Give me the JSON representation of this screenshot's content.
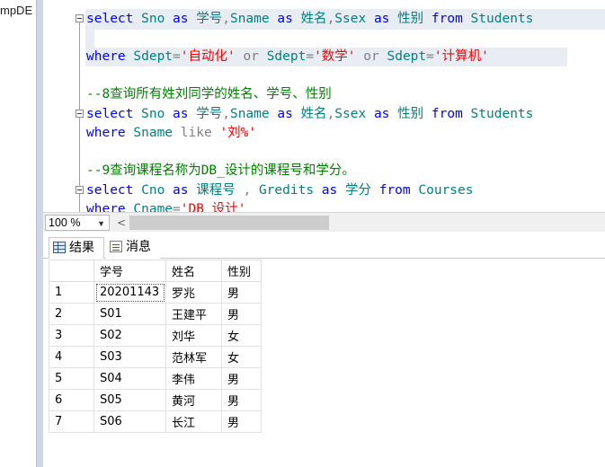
{
  "left_pane": {
    "db_label": "mpDE"
  },
  "editor": {
    "lines": [
      [
        [
          "kw",
          "select "
        ],
        [
          "id",
          "Sno "
        ],
        [
          "kw",
          "as "
        ],
        [
          "tx",
          "学号"
        ],
        [
          "op",
          ","
        ],
        [
          "id",
          "Sname "
        ],
        [
          "kw",
          "as "
        ],
        [
          "tx",
          "姓名"
        ],
        [
          "op",
          ","
        ],
        [
          "id",
          "Ssex "
        ],
        [
          "kw",
          "as "
        ],
        [
          "tx",
          "性别 "
        ],
        [
          "kw",
          "from "
        ],
        [
          "id",
          "Students"
        ]
      ],
      [
        [
          "kw",
          "where "
        ],
        [
          "id",
          "Sdept"
        ],
        [
          "op",
          "="
        ],
        [
          "str",
          "'自动化' "
        ],
        [
          "op",
          "or "
        ],
        [
          "id",
          "Sdept"
        ],
        [
          "op",
          "="
        ],
        [
          "str",
          "'数学' "
        ],
        [
          "op",
          "or "
        ],
        [
          "id",
          "Sdept"
        ],
        [
          "op",
          "="
        ],
        [
          "str",
          "'计算机'"
        ]
      ],
      [
        [
          "cm",
          "--8查询所有姓刘同学的姓名、学号、性别"
        ]
      ],
      [
        [
          "kw",
          "select "
        ],
        [
          "id",
          "Sno "
        ],
        [
          "kw",
          "as "
        ],
        [
          "tx",
          "学号"
        ],
        [
          "op",
          ","
        ],
        [
          "id",
          "Sname "
        ],
        [
          "kw",
          "as "
        ],
        [
          "tx",
          "姓名"
        ],
        [
          "op",
          ","
        ],
        [
          "id",
          "Ssex "
        ],
        [
          "kw",
          "as "
        ],
        [
          "tx",
          "性别 "
        ],
        [
          "kw",
          "from "
        ],
        [
          "id",
          "Students"
        ]
      ],
      [
        [
          "kw",
          "where "
        ],
        [
          "id",
          "Sname "
        ],
        [
          "op",
          "like "
        ],
        [
          "str",
          "'刘%'"
        ]
      ],
      [
        [
          "cm",
          "--9查询课程名称为DB_设计的课程号和学分。"
        ]
      ],
      [
        [
          "kw",
          "select "
        ],
        [
          "id",
          "Cno "
        ],
        [
          "kw",
          "as "
        ],
        [
          "tx",
          "课程号 "
        ],
        [
          "op",
          ", "
        ],
        [
          "id",
          "Gredits "
        ],
        [
          "kw",
          "as "
        ],
        [
          "tx",
          "学分 "
        ],
        [
          "kw",
          "from "
        ],
        [
          "id",
          "Courses"
        ]
      ],
      [
        [
          "kw",
          "where "
        ],
        [
          "id",
          "Cname"
        ],
        [
          "op",
          "="
        ],
        [
          "str",
          "'DB_设计'"
        ]
      ]
    ]
  },
  "zoom": {
    "value": "100 %"
  },
  "tabs": {
    "results": "结果",
    "messages": "消息"
  },
  "grid": {
    "headers": [
      "学号",
      "姓名",
      "性别"
    ],
    "rows": [
      [
        "1",
        "20201143",
        "罗兆",
        "男"
      ],
      [
        "2",
        "S01",
        "王建平",
        "男"
      ],
      [
        "3",
        "S02",
        "刘华",
        "女"
      ],
      [
        "4",
        "S03",
        "范林军",
        "女"
      ],
      [
        "5",
        "S04",
        "李伟",
        "男"
      ],
      [
        "6",
        "S05",
        "黄河",
        "男"
      ],
      [
        "7",
        "S06",
        "长江",
        "男"
      ]
    ]
  }
}
